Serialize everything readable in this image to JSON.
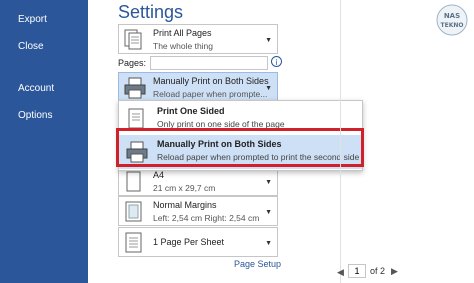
{
  "sidebar": {
    "items": [
      {
        "label": "Export"
      },
      {
        "label": "Close"
      },
      {
        "label": "Account"
      },
      {
        "label": "Options"
      }
    ]
  },
  "main": {
    "title": "Settings",
    "print_what": {
      "line1": "Print All Pages",
      "line2": "The whole thing"
    },
    "pages_label": "Pages:",
    "pages_value": "",
    "duplex": {
      "line1": "Manually Print on Both Sides",
      "line2": "Reload paper when prompte..."
    },
    "flyout": [
      {
        "title": "Print One Sided",
        "desc": "Only print on one side of the page"
      },
      {
        "title": "Manually Print on Both Sides",
        "desc": "Reload paper when prompted to print the second side"
      }
    ],
    "paper": {
      "line1": "A4",
      "line2": "21 cm x 29,7 cm"
    },
    "margins": {
      "line1": "Normal Margins",
      "line2": "Left:  2,54 cm    Right:  2,54 cm"
    },
    "per_sheet": {
      "line1": "1 Page Per Sheet"
    },
    "page_setup_link": "Page Setup"
  },
  "pager": {
    "current": "1",
    "of_text": "of 2"
  },
  "logo": {
    "text": "NAS TEKNO"
  },
  "colors": {
    "sidebar": "#2b579a",
    "accent": "#2b579a",
    "highlight_box": "#d0202a",
    "selection": "#cde0f5"
  }
}
